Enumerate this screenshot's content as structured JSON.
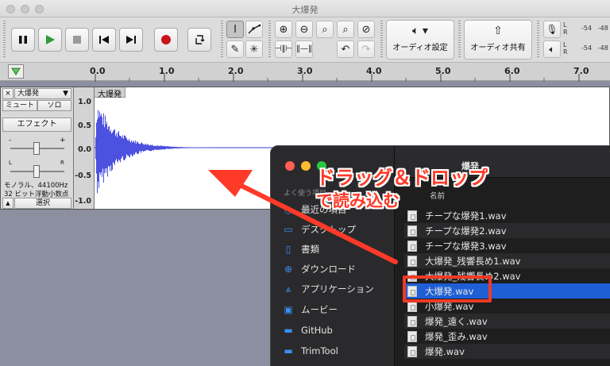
{
  "window": {
    "title": "大爆発"
  },
  "toolbar": {
    "transport": [
      "pause",
      "play",
      "stop",
      "skip-start",
      "skip-end",
      "record",
      "loop"
    ],
    "audio_setup_label": "オーディオ設定",
    "audio_share_label": "オーディオ共有",
    "meter": {
      "record": {
        "l": "L",
        "r": "R",
        "val": "-54",
        "val2": "-48"
      },
      "play": {
        "l": "L",
        "r": "R",
        "val": "-54",
        "val2": "-48"
      }
    }
  },
  "ruler": {
    "ticks": [
      "0.0",
      "1.0",
      "2.0",
      "3.0",
      "4.0",
      "5.0",
      "6.0",
      "7.0"
    ]
  },
  "track": {
    "name": "大爆発",
    "close": "×",
    "mute": "ミュート",
    "solo": "ソロ",
    "effects": "エフェクト",
    "gain_minus": "-",
    "gain_plus": "+",
    "pan_l": "L",
    "pan_r": "R",
    "info_line1": "モノラル、44100Hz",
    "info_line2": "32 ビット浮動小数点数",
    "select": "選択",
    "scale": [
      "1.0",
      "0.5",
      "0.0",
      "-0.5",
      "-1.0"
    ]
  },
  "finder": {
    "title": "爆発",
    "sidebar_header": "よく使う項目",
    "sidebar": [
      {
        "icon": "clock-icon",
        "label": "最近の項目"
      },
      {
        "icon": "desktop-icon",
        "label": "デスクトップ"
      },
      {
        "icon": "document-icon",
        "label": "書類"
      },
      {
        "icon": "download-icon",
        "label": "ダウンロード"
      },
      {
        "icon": "applications-icon",
        "label": "アプリケーション"
      },
      {
        "icon": "movies-icon",
        "label": "ムービー"
      },
      {
        "icon": "folder-icon",
        "label": "GitHub"
      },
      {
        "icon": "folder-icon",
        "label": "TrimTool"
      }
    ],
    "column_header": "名前",
    "files": [
      "チープな爆発1.wav",
      "チープな爆発2.wav",
      "チープな爆発3.wav",
      "大爆発_残響長め1.wav",
      "大爆発_残響長め2.wav",
      "大爆発.wav",
      "小爆発.wav",
      "爆発_遠く.wav",
      "爆発_歪み.wav",
      "爆発.wav"
    ],
    "selected_index": 5
  },
  "annotation": {
    "line1": "ドラッグ＆ドロップ",
    "line2": "で読み込む",
    "color": "#ff3a28"
  }
}
